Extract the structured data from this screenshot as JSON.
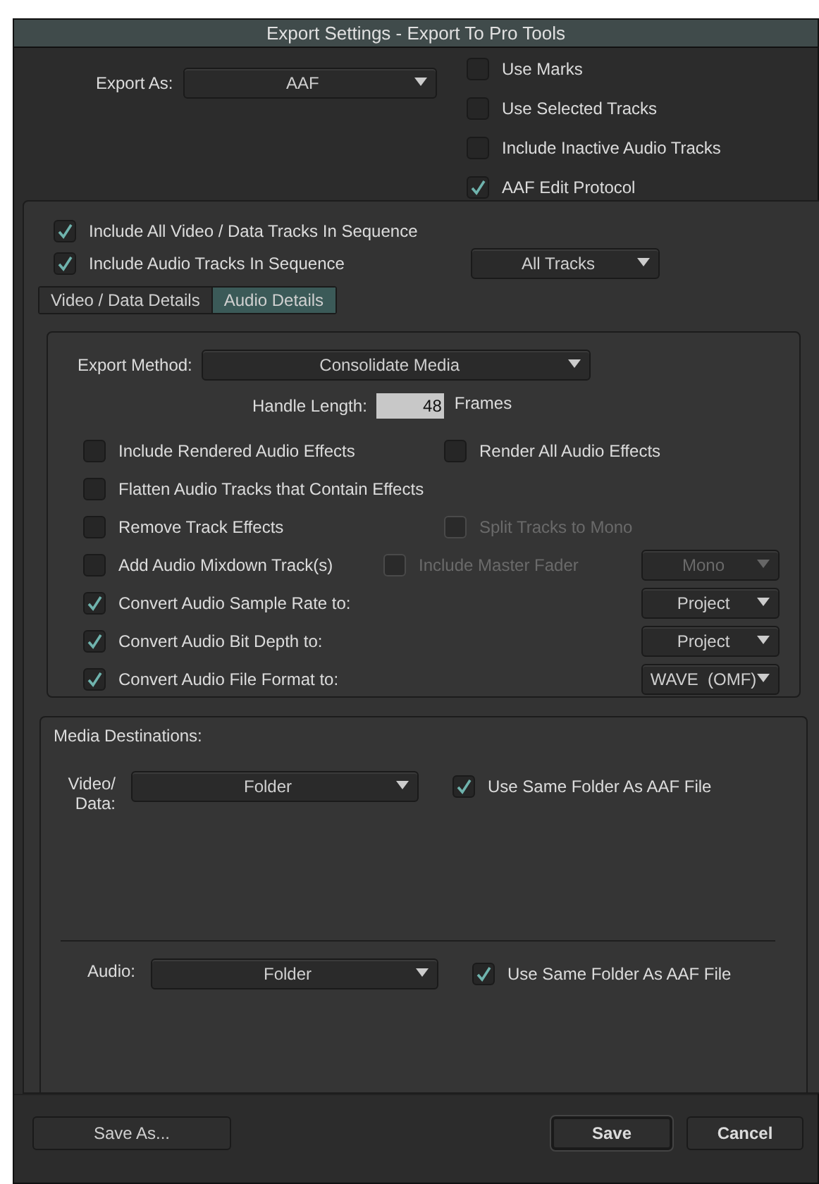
{
  "window": {
    "title": "Export Settings - Export To Pro Tools"
  },
  "export_as": {
    "label": "Export As:",
    "value": "AAF"
  },
  "export_options": [
    {
      "label": "Use Marks",
      "checked": false
    },
    {
      "label": "Use Selected Tracks",
      "checked": false
    },
    {
      "label": "Include Inactive Audio Tracks",
      "checked": false
    },
    {
      "label": "AAF Edit Protocol",
      "checked": true
    }
  ],
  "include_video": {
    "label": "Include All Video / Data Tracks In Sequence",
    "checked": true
  },
  "include_audio": {
    "label": "Include Audio Tracks In Sequence",
    "checked": true,
    "dropdown": "All Tracks"
  },
  "tabs": [
    {
      "label": "Video / Data Details",
      "selected": false
    },
    {
      "label": "Audio Details",
      "selected": true
    }
  ],
  "export_method": {
    "label": "Export Method:",
    "value": "Consolidate Media"
  },
  "handle_length": {
    "label": "Handle Length:",
    "value": "48",
    "unit": "Frames"
  },
  "audio_options": [
    [
      {
        "kind": "checkbox",
        "label": "Include Rendered Audio Effects",
        "checked": false,
        "disabled": false
      },
      {
        "kind": "checkbox",
        "label": "Render All Audio Effects",
        "checked": false,
        "disabled": false
      }
    ],
    [
      {
        "kind": "checkbox",
        "label": "Flatten Audio Tracks that Contain Effects",
        "checked": false,
        "disabled": false
      }
    ],
    [
      {
        "kind": "checkbox",
        "label": "Remove Track Effects",
        "checked": false,
        "disabled": false
      },
      {
        "kind": "checkbox",
        "label": "Split Tracks to Mono",
        "checked": false,
        "disabled": true
      }
    ],
    [
      {
        "kind": "checkbox",
        "label": "Add Audio Mixdown Track(s)",
        "checked": false,
        "disabled": false
      },
      {
        "kind": "checkbox",
        "label": "Include Master Fader",
        "checked": false,
        "disabled": true
      },
      {
        "kind": "dropdown",
        "value": "Mono",
        "disabled": true
      }
    ],
    [
      {
        "kind": "checkbox",
        "label": "Convert Audio Sample Rate to:",
        "checked": true,
        "disabled": false
      },
      {
        "kind": "dropdown",
        "value": "Project",
        "disabled": false
      }
    ],
    [
      {
        "kind": "checkbox",
        "label": "Convert Audio Bit Depth to:",
        "checked": true,
        "disabled": false
      },
      {
        "kind": "dropdown",
        "value": "Project",
        "disabled": false
      }
    ],
    [
      {
        "kind": "checkbox",
        "label": "Convert Audio File Format to:",
        "checked": true,
        "disabled": false
      },
      {
        "kind": "dropdown",
        "value": "WAVE  (OMF)",
        "disabled": false
      }
    ]
  ],
  "media_destinations": {
    "title": "Media Destinations:",
    "rows": [
      {
        "label": "Video/ Data:",
        "value": "Folder",
        "same_folder": {
          "label": "Use Same Folder As AAF File",
          "checked": true
        }
      },
      {
        "label": "Audio:",
        "value": "Folder",
        "same_folder": {
          "label": "Use Same Folder As AAF File",
          "checked": true
        }
      }
    ]
  },
  "buttons": {
    "save_as": "Save As...",
    "save": "Save",
    "cancel": "Cancel"
  }
}
